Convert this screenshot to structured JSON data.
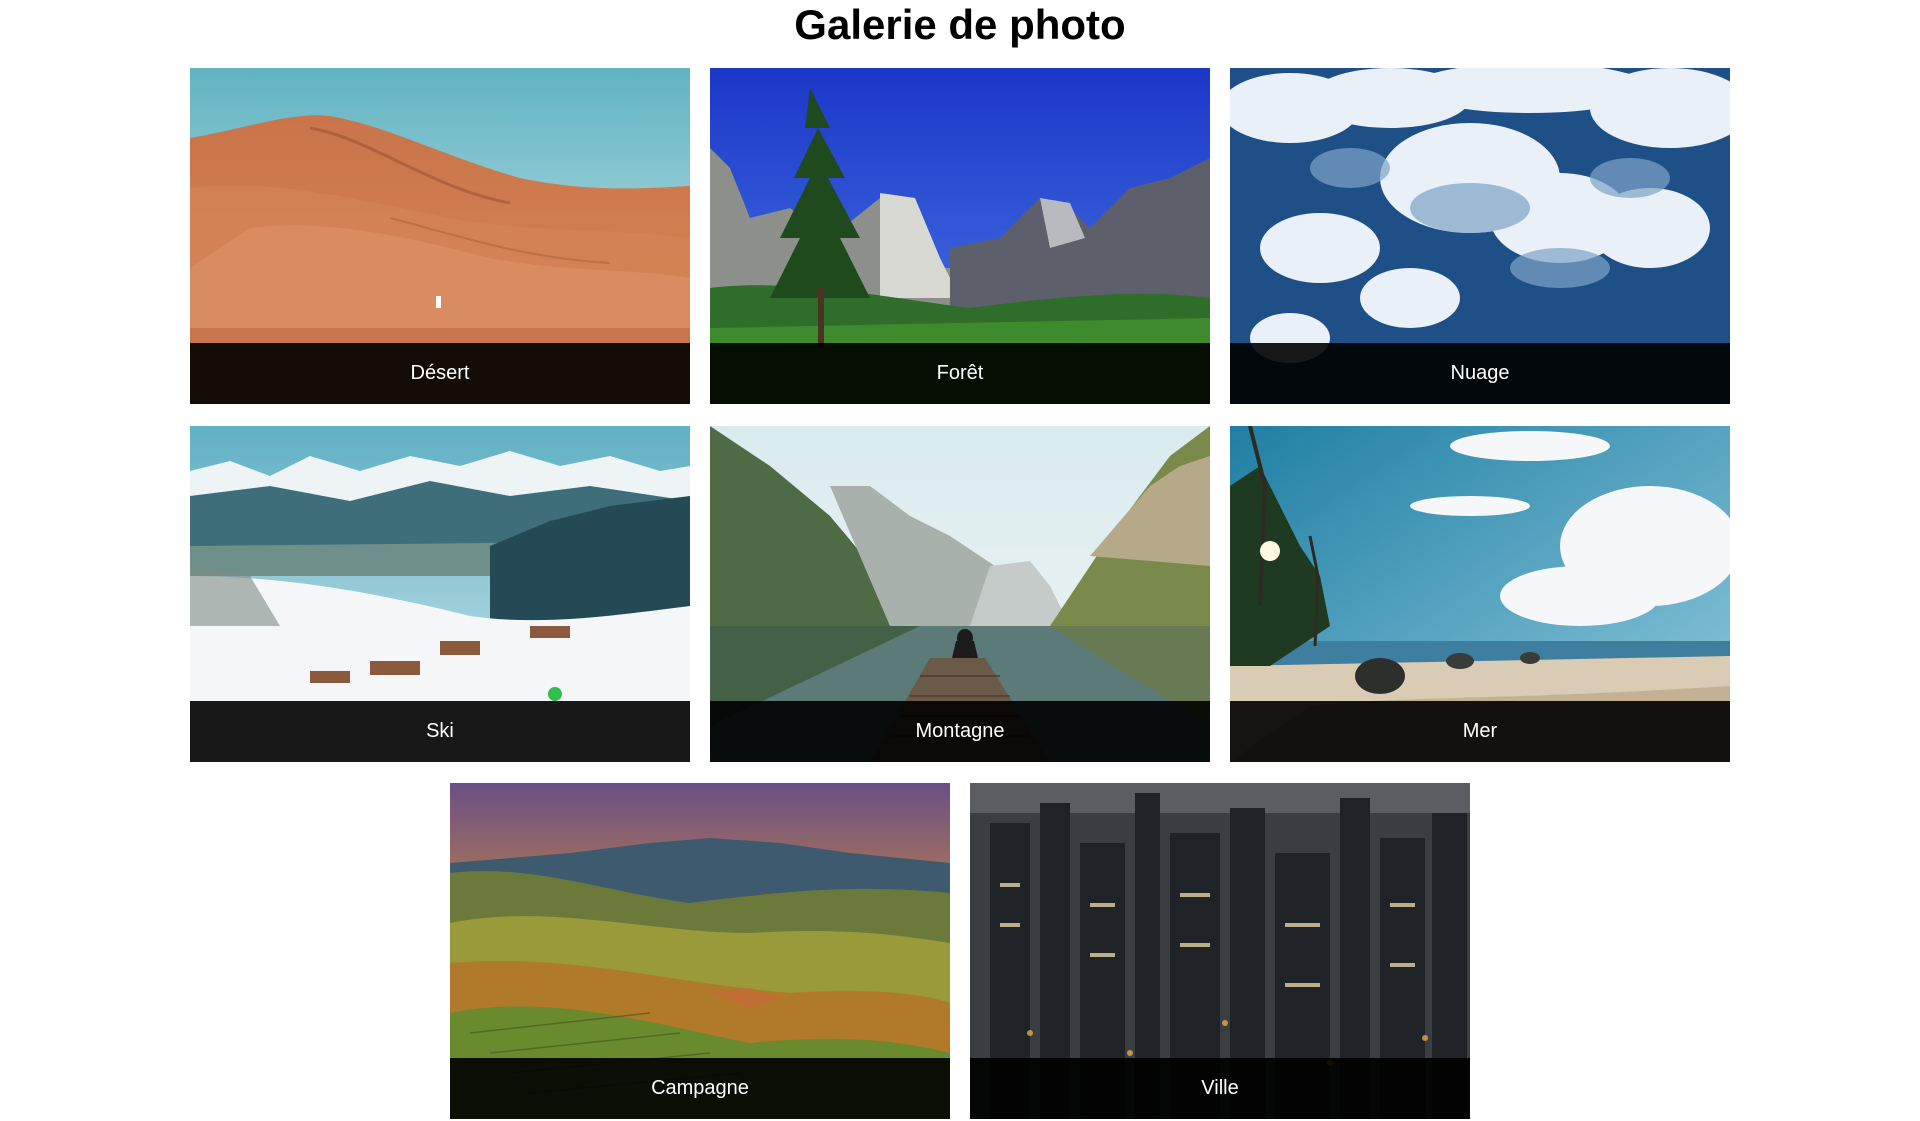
{
  "page": {
    "title": "Galerie de photo"
  },
  "gallery": {
    "items": [
      {
        "caption": "Désert",
        "image": "desert-dunes-photo"
      },
      {
        "caption": "Forêt",
        "image": "forest-valley-photo"
      },
      {
        "caption": "Nuage",
        "image": "clouds-photo"
      },
      {
        "caption": "Ski",
        "image": "snowy-ski-mountains-photo"
      },
      {
        "caption": "Montagne",
        "image": "mountain-lake-photo"
      },
      {
        "caption": "Mer",
        "image": "tropical-beach-photo"
      },
      {
        "caption": "Campagne",
        "image": "countryside-hills-photo"
      },
      {
        "caption": "Ville",
        "image": "city-night-skyline-photo"
      }
    ]
  }
}
